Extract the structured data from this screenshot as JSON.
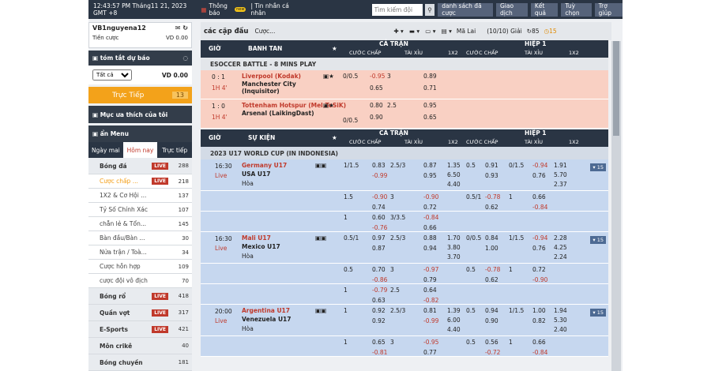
{
  "topbar": {
    "time": "12:43:57 PM Tháng11 21, 2023 GMT +8",
    "notif": "Thông báo",
    "newb": "new",
    "msg": "Tin nhắn cá nhân",
    "search": "Tìm kiếm đội",
    "b1": "danh sách đã cược",
    "b2": "Giao dịch",
    "b3": "Kết quả",
    "b4": "Tuỳ chọn",
    "b5": "Trợ giúp"
  },
  "acct": {
    "name": "VB1nguyena12",
    "credit_label": "Tiền cược",
    "credit": "VD  0.00"
  },
  "summary": {
    "title": "tóm tắt dự báo",
    "filter": "Tất cả",
    "val": "VD 0.00"
  },
  "live": {
    "label": "Trực Tiếp",
    "count": "13"
  },
  "fav": "Mục ưa thích của tôi",
  "menu": "ẩn Menu",
  "tabs": [
    "Ngày mai",
    "Hôm nay",
    "Trực tiếp"
  ],
  "sports": [
    {
      "l": "Bóng đá",
      "c": "288",
      "live": true
    },
    {
      "l": "Cược chấp ...",
      "c": "218",
      "live": true,
      "sub": true,
      "sel": true
    },
    {
      "l": "1X2 & Cơ Hội ...",
      "c": "137",
      "sub": true
    },
    {
      "l": "Tỷ Số Chính Xác",
      "c": "107",
      "sub": true
    },
    {
      "l": "chẵn lẻ & Tổn...",
      "c": "145",
      "sub": true
    },
    {
      "l": "Bàn đầu/Bàn ...",
      "c": "30",
      "sub": true
    },
    {
      "l": "Nửa trận / Toà...",
      "c": "34",
      "sub": true
    },
    {
      "l": "Cược hỗn hợp",
      "c": "109",
      "sub": true
    },
    {
      "l": "cược đội vô địch",
      "c": "70",
      "sub": true
    },
    {
      "l": "Bóng rổ",
      "c": "418",
      "live": true
    },
    {
      "l": "Quần vợt",
      "c": "317",
      "live": true
    },
    {
      "l": "E-Sports",
      "c": "421",
      "live": true
    },
    {
      "l": "Môn crikê",
      "c": "40"
    },
    {
      "l": "Bóng chuyền",
      "c": "181"
    }
  ],
  "filterbar": {
    "title": "các cặp đấu",
    "c": "Cược...",
    "sort": "Mã Lai",
    "count": "(10/10) Giải",
    "n1": "85",
    "n2": "15"
  },
  "headers": {
    "gio": "GIỜ",
    "banh": "BANH TAN",
    "su": "SỰ KIỆN",
    "full": "CẢ TRẬN",
    "half": "HIỆP 1",
    "cc": "CƯỚC CHẤP",
    "tx": "TÀI XỈU",
    "x12": "1X2"
  },
  "league1": "ESOCCER BATTLE - 8 MINS PLAY",
  "league2": "2023 U17 WORLD CUP (IN INDONESIA)",
  "draw": "Hòa",
  "e1": [
    {
      "s": "0 : 1",
      "t": "1H 4'",
      "h": "Liverpool (Kodak)",
      "a": "Manchester City (Inquisitor)",
      "hc": "0/0.5",
      "o1": "-0.95",
      "o2": "0.65",
      "g": "3",
      "u1": "0.89",
      "u2": "0.71"
    },
    {
      "s": "1 : 0",
      "t": "1H 4'",
      "h": "Tottenham Hotspur (Mel.ToSiK)",
      "a": "Arsenal (LaikingDast)",
      "hc": "0/0.5",
      "o1": "0.80",
      "o2": "0.90",
      "g": "2.5",
      "u1": "0.95",
      "u2": "0.65"
    }
  ],
  "m": [
    {
      "tm": "16:30",
      "lv": "Live",
      "h": "Germany U17",
      "a": "USA U17"
    },
    {
      "tm": "16:30",
      "lv": "Live",
      "h": "Mali U17",
      "a": "Mexico U17"
    },
    {
      "tm": "20:00",
      "lv": "Live",
      "h": "Argentina U17",
      "a": "Venezuela U17"
    }
  ],
  "more": "15",
  "odds": [
    [
      "1/1.5",
      "0.83",
      "-0.99",
      "2.5/3",
      "0.87",
      "0.95",
      "1.35",
      "6.50",
      "4.40",
      "0.5",
      "0.91",
      "0.93",
      "0/1.5",
      "-0.94",
      "0.76",
      "1.91",
      "5.70",
      "2.37"
    ],
    [
      "1.5",
      "-0.90",
      "0.74",
      "3",
      "-0.90",
      "0.72",
      "",
      "",
      "",
      "0.5/1",
      "-0.78",
      "0.62",
      "1",
      "0.66",
      "-0.84",
      "",
      "",
      ""
    ],
    [
      "1",
      "0.60",
      "-0.76",
      "3/3.5",
      "-0.84",
      "0.66",
      "",
      "",
      "",
      "",
      "",
      "",
      "",
      "",
      "",
      "",
      "",
      ""
    ],
    [
      "0.5/1",
      "0.97",
      "0.87",
      "2.5/3",
      "0.88",
      "0.94",
      "1.70",
      "3.80",
      "3.70",
      "0/0.5",
      "0.84",
      "1.00",
      "1/1.5",
      "-0.94",
      "0.76",
      "2.28",
      "4.25",
      "2.24"
    ],
    [
      "0.5",
      "0.70",
      "-0.86",
      "3",
      "-0.97",
      "0.79",
      "",
      "",
      "",
      "0.5",
      "-0.78",
      "0.62",
      "1",
      "0.72",
      "-0.90",
      "",
      "",
      ""
    ],
    [
      "1",
      "-0.79",
      "0.63",
      "2.5",
      "0.64",
      "-0.82",
      "",
      "",
      "",
      "",
      "",
      "",
      "",
      "",
      "",
      "",
      "",
      ""
    ],
    [
      "1",
      "0.92",
      "0.92",
      "2.5/3",
      "0.81",
      "-0.99",
      "1.39",
      "6.00",
      "4.40",
      "0.5",
      "0.94",
      "0.90",
      "1/1.5",
      "1.00",
      "0.82",
      "1.94",
      "5.30",
      "2.40"
    ],
    [
      "1",
      "0.65",
      "-0.81",
      "3",
      "-0.95",
      "0.77",
      "",
      "",
      "",
      "0.5",
      "0.56",
      "-0.72",
      "1",
      "0.66",
      "-0.84",
      "",
      "",
      ""
    ]
  ]
}
